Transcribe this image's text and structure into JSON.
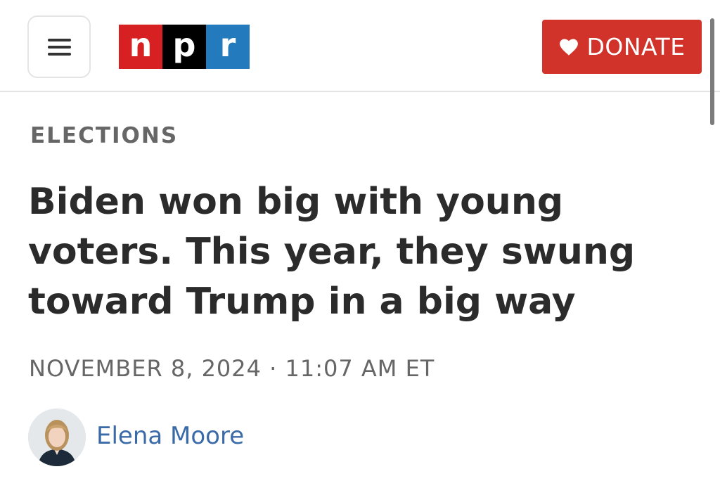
{
  "header": {
    "menu_icon": "hamburger-menu-icon",
    "logo": {
      "letters": [
        "n",
        "p",
        "r"
      ],
      "colors": [
        "#d62021",
        "#000000",
        "#237bbd"
      ]
    },
    "donate_label": "DONATE",
    "donate_icon": "heart-icon",
    "accent_color": "#d1322a"
  },
  "article": {
    "section": "ELECTIONS",
    "headline": "Biden won big with young voters. This year, they swung toward Trump in a big way",
    "dateline": "NOVEMBER 8, 2024 · 11:07 AM ET",
    "author": {
      "name": "Elena Moore",
      "avatar_icon": "author-avatar"
    }
  }
}
